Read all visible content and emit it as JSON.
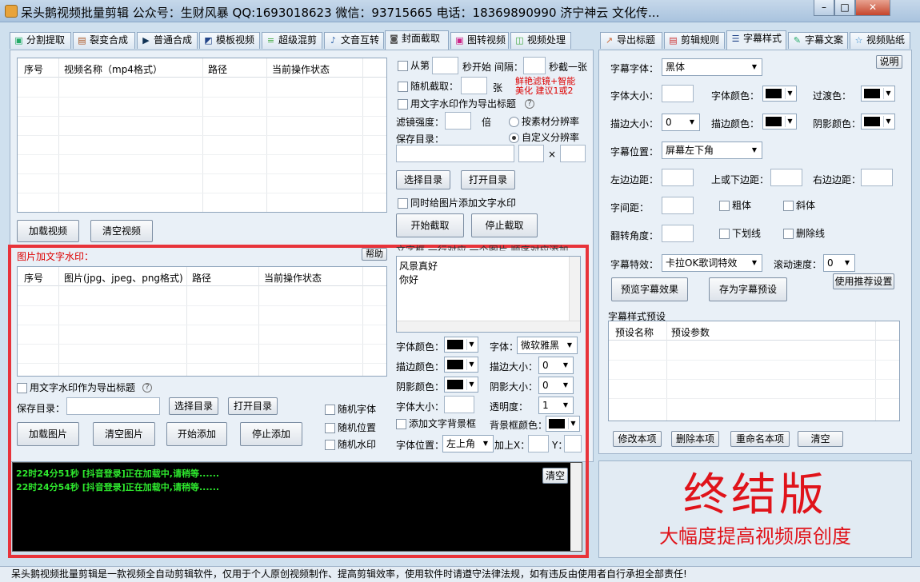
{
  "window": {
    "title": "呆头鹅视频批量剪辑 公众号：生财风暴 QQ:1693018623 微信：93715665 电话：18369890990 济宁神云 文化传..."
  },
  "left_tabs": [
    "分割提取",
    "裂变合成",
    "普通合成",
    "模板视频",
    "超级混剪",
    "文音互转",
    "封面截取",
    "图转视频",
    "视频处理"
  ],
  "right_tabs": [
    "导出标题",
    "剪辑规则",
    "字幕样式",
    "字幕文案",
    "视频贴纸"
  ],
  "video_list": {
    "headers": [
      "序号",
      "视频名称（mp4格式）",
      "路径",
      "当前操作状态"
    ]
  },
  "video_buttons": {
    "load": "加载视频",
    "clear": "清空视频"
  },
  "cover": {
    "from_label": "从第",
    "sec_start_label": "秒开始 间隔：",
    "sec_per_label": "秒截一张",
    "random_label": "随机截取：",
    "sheets_label": "张",
    "filter_note_1": "鲜艳滤镜+智能",
    "filter_note_2": "美化 建议1或2",
    "text_wm_title": "用文字水印作为导出标题",
    "filter_strength": "滤镜强度：",
    "times": "倍",
    "by_material_res": "按素材分辨率",
    "custom_res": "自定义分辨率",
    "save_dir": "保存目录：",
    "x": "×",
    "choose_dir": "选择目录",
    "open_dir": "打开目录",
    "also_wm": "同时给图片添加文字水印",
    "start": "开始截取",
    "stop": "停止截取"
  },
  "watermark": {
    "title": "图片加文字水印：",
    "help": "帮助",
    "headers": [
      "序号",
      "图片(jpg、jpeg、png格式)",
      "路径",
      "当前操作状态"
    ],
    "text_box_label": "文字框 一行对应 一个图片 顺序对应添加",
    "text_lines": [
      "风景真好",
      "你好"
    ],
    "use_as_title": "用文字水印作为导出标题",
    "save_dir": "保存目录：",
    "choose_dir": "选择目录",
    "open_dir": "打开目录",
    "random_font": "随机字体",
    "random_pos": "随机位置",
    "random_wm": "随机水印",
    "load_img": "加载图片",
    "clear_img": "清空图片",
    "start": "开始添加",
    "stop": "停止添加",
    "font_color": "字体颜色：",
    "font": "字体：",
    "font_value": "微软雅黑",
    "stroke_color": "描边颜色：",
    "stroke_size": "描边大小：",
    "stroke_size_value": "0",
    "shadow_color": "阴影颜色：",
    "shadow_size": "阴影大小：",
    "shadow_size_value": "0",
    "font_size": "字体大小：",
    "opacity": "透明度：",
    "opacity_value": "1",
    "add_bg": "添加文字背景框",
    "bg_color": "背景框颜色：",
    "font_pos": "字体位置：",
    "font_pos_value": "左上角",
    "add_x": "加上X：",
    "y": "Y："
  },
  "log": {
    "lines": [
      "22时24分51秒 [抖音登录]正在加载中,请稍等......",
      "22时24分54秒 [抖音登录]正在加载中,请稍等......"
    ],
    "clear": "清空"
  },
  "subtitle": {
    "font": "字幕字体：",
    "font_value": "黑体",
    "explain": "说明",
    "font_size": "字体大小：",
    "font_color": "字体颜色：",
    "transition": "过渡色：",
    "stroke_size": "描边大小：",
    "stroke_size_value": "0",
    "stroke_color": "描边颜色：",
    "shadow_color": "阴影颜色：",
    "position": "字幕位置：",
    "position_value": "屏幕左下角",
    "left_margin": "左边边距：",
    "tb_margin": "上或下边距：",
    "right_margin": "右边边距：",
    "spacing": "字间距：",
    "bold": "粗体",
    "italic": "斜体",
    "rotate": "翻转角度：",
    "underline": "下划线",
    "strike": "删除线",
    "effect": "字幕特效：",
    "effect_value": "卡拉OK歌词特效",
    "scroll_speed": "滚动速度：",
    "scroll_value": "0",
    "preview": "预览字幕效果",
    "save_preset": "存为字幕预设",
    "use_recommended": "使用推荐设置",
    "preset_title": "字幕样式预设",
    "preset_headers": [
      "预设名称",
      "预设参数"
    ],
    "modify": "修改本项",
    "delete": "删除本项",
    "rename": "重命名本项",
    "clear": "清空"
  },
  "promo": {
    "main": "终结版",
    "sub": "大幅度提高视频原创度"
  },
  "status": "呆头鹅视频批量剪辑是一款视频全自动剪辑软件，仅用于个人原创视频制作、提高剪辑效率，使用软件时请遵守法律法规，如有违反由使用者自行承担全部责任!",
  "colors": {
    "highlight_red": "#e8333a",
    "log_green": "#2ee82e",
    "promo_red": "#e0131a"
  }
}
